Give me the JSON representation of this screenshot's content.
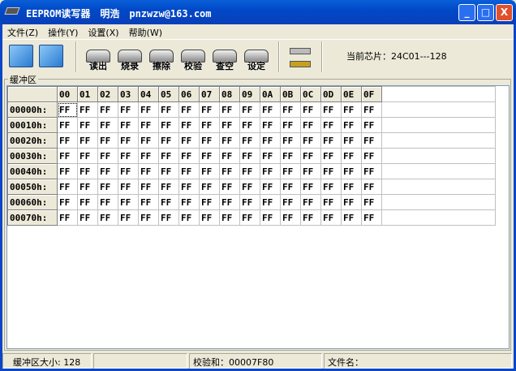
{
  "window": {
    "title": "EEPROM读写器　明浩　pnzwzw@163.com",
    "minimize": "_",
    "maximize": "□",
    "close": "X"
  },
  "menu": [
    "文件(Z)",
    "操作(Y)",
    "设置(X)",
    "帮助(W)"
  ],
  "toolbar": {
    "buttons": [
      "读出",
      "烧录",
      "擦除",
      "校验",
      "查空",
      "设定"
    ],
    "chip_info": "当前芯片：24C01---128"
  },
  "buffer": {
    "label": "缓冲区",
    "columns": [
      "00",
      "01",
      "02",
      "03",
      "04",
      "05",
      "06",
      "07",
      "08",
      "09",
      "0A",
      "0B",
      "0C",
      "0D",
      "0E",
      "0F"
    ],
    "rows": [
      {
        "addr": "00000h:",
        "values": [
          "FF",
          "FF",
          "FF",
          "FF",
          "FF",
          "FF",
          "FF",
          "FF",
          "FF",
          "FF",
          "FF",
          "FF",
          "FF",
          "FF",
          "FF",
          "FF"
        ]
      },
      {
        "addr": "00010h:",
        "values": [
          "FF",
          "FF",
          "FF",
          "FF",
          "FF",
          "FF",
          "FF",
          "FF",
          "FF",
          "FF",
          "FF",
          "FF",
          "FF",
          "FF",
          "FF",
          "FF"
        ]
      },
      {
        "addr": "00020h:",
        "values": [
          "FF",
          "FF",
          "FF",
          "FF",
          "FF",
          "FF",
          "FF",
          "FF",
          "FF",
          "FF",
          "FF",
          "FF",
          "FF",
          "FF",
          "FF",
          "FF"
        ]
      },
      {
        "addr": "00030h:",
        "values": [
          "FF",
          "FF",
          "FF",
          "FF",
          "FF",
          "FF",
          "FF",
          "FF",
          "FF",
          "FF",
          "FF",
          "FF",
          "FF",
          "FF",
          "FF",
          "FF"
        ]
      },
      {
        "addr": "00040h:",
        "values": [
          "FF",
          "FF",
          "FF",
          "FF",
          "FF",
          "FF",
          "FF",
          "FF",
          "FF",
          "FF",
          "FF",
          "FF",
          "FF",
          "FF",
          "FF",
          "FF"
        ]
      },
      {
        "addr": "00050h:",
        "values": [
          "FF",
          "FF",
          "FF",
          "FF",
          "FF",
          "FF",
          "FF",
          "FF",
          "FF",
          "FF",
          "FF",
          "FF",
          "FF",
          "FF",
          "FF",
          "FF"
        ]
      },
      {
        "addr": "00060h:",
        "values": [
          "FF",
          "FF",
          "FF",
          "FF",
          "FF",
          "FF",
          "FF",
          "FF",
          "FF",
          "FF",
          "FF",
          "FF",
          "FF",
          "FF",
          "FF",
          "FF"
        ]
      },
      {
        "addr": "00070h:",
        "values": [
          "FF",
          "FF",
          "FF",
          "FF",
          "FF",
          "FF",
          "FF",
          "FF",
          "FF",
          "FF",
          "FF",
          "FF",
          "FF",
          "FF",
          "FF",
          "FF"
        ]
      }
    ]
  },
  "status": {
    "buffer_size": "缓冲区大小: 128",
    "blank": "",
    "checksum": "校验和：00007F80",
    "filename": "文件名："
  }
}
